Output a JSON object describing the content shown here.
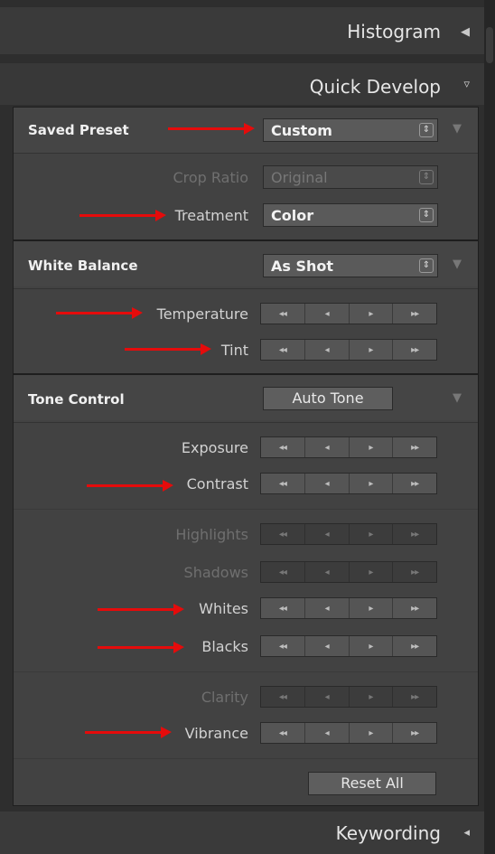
{
  "histogram": {
    "title": "Histogram",
    "icon": "collapse-left-icon"
  },
  "quick_develop": {
    "title": "Quick Develop",
    "icon": "panel-expanded-icon"
  },
  "saved_preset": {
    "label": "Saved Preset",
    "value": "Custom"
  },
  "crop_ratio": {
    "label": "Crop Ratio",
    "value": "Original"
  },
  "treatment": {
    "label": "Treatment",
    "value": "Color"
  },
  "white_balance": {
    "label": "White Balance",
    "value": "As Shot"
  },
  "temperature": {
    "label": "Temperature"
  },
  "tint": {
    "label": "Tint"
  },
  "tone_control": {
    "label": "Tone Control",
    "auto_tone": "Auto Tone"
  },
  "exposure": {
    "label": "Exposure"
  },
  "contrast": {
    "label": "Contrast"
  },
  "highlights": {
    "label": "Highlights"
  },
  "shadows": {
    "label": "Shadows"
  },
  "whites": {
    "label": "Whites"
  },
  "blacks": {
    "label": "Blacks"
  },
  "clarity": {
    "label": "Clarity"
  },
  "vibrance": {
    "label": "Vibrance"
  },
  "reset_all": "Reset All",
  "keywording": {
    "title": "Keywording",
    "icon": "collapse-left-icon"
  },
  "stepper_glyphs": [
    "◂◂",
    "◂",
    "▸",
    "▸▸"
  ],
  "colors": {
    "annotation_arrow": "#e50b0b",
    "panel_bg": "#424242"
  }
}
